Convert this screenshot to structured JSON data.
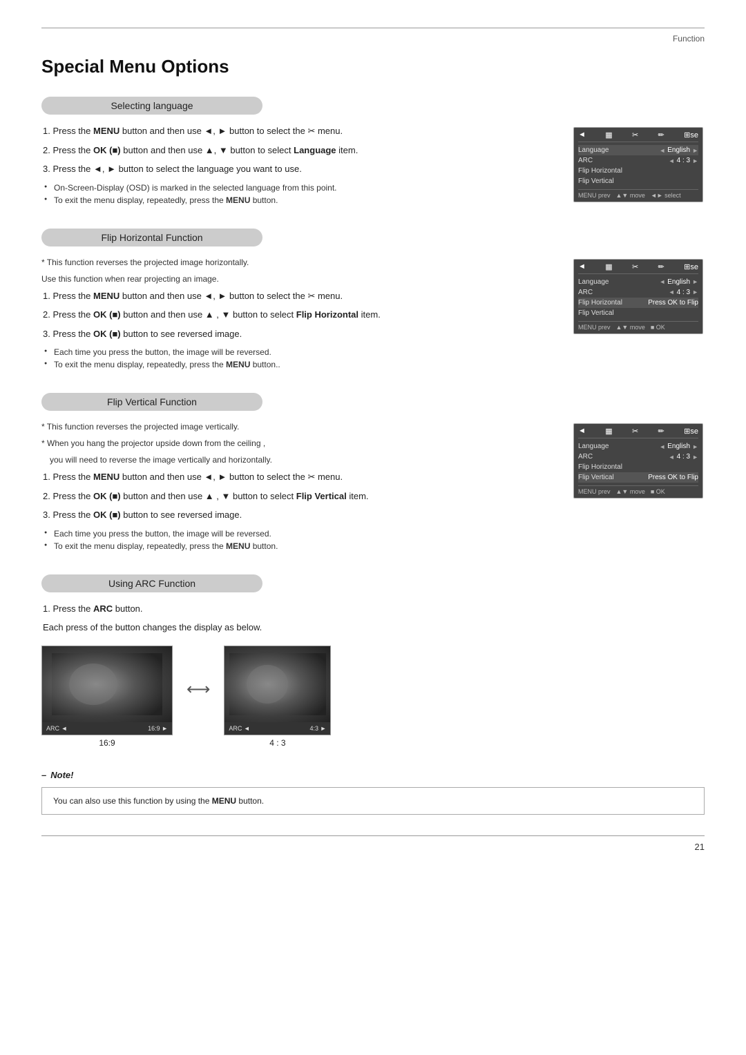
{
  "header": {
    "function_label": "Function"
  },
  "page": {
    "title": "Special Menu Options",
    "number": "21"
  },
  "sections": [
    {
      "id": "selecting-language",
      "title": "Selecting language",
      "asterisk_notes": [],
      "steps": [
        {
          "num": "1.",
          "text_before": "Press the ",
          "bold1": "MENU",
          "text_mid": " button and then use ◄, ► button to select the",
          "icon": "scissors",
          "text_after": "menu."
        },
        {
          "num": "2.",
          "text_before": "Press the ",
          "bold1": "OK (■)",
          "text_mid": " button and then use ▲, ▼ button to select ",
          "bold2": "Language",
          "text_after": " item."
        },
        {
          "num": "3.",
          "text": "Press the ◄, ► button to select the language you want to use."
        }
      ],
      "sub_notes": [
        "On-Screen-Display (OSD) is marked in the selected language from this point.",
        "To exit the menu display, repeatedly, press the MENU button."
      ],
      "menu": {
        "highlighted_row": "Language",
        "rows": [
          {
            "label": "Language",
            "arrow_left": "◄",
            "value": "English",
            "arrow_right": "►",
            "highlight": true
          },
          {
            "label": "ARC",
            "arrow_left": "◄",
            "value": "4 : 3",
            "arrow_right": "►"
          },
          {
            "label": "Flip Horizontal",
            "arrow_left": "",
            "value": "",
            "arrow_right": ""
          },
          {
            "label": "Flip Vertical",
            "arrow_left": "",
            "value": "",
            "arrow_right": ""
          }
        ],
        "footer": [
          "MENU prev",
          "▲▼ move",
          "◄► select"
        ]
      }
    },
    {
      "id": "flip-horizontal",
      "title": "Flip Horizontal Function",
      "asterisk_notes": [
        "This function reverses the projected image horizontally.",
        "Use this function when rear projecting an image."
      ],
      "steps": [
        {
          "num": "1.",
          "text_before": "Press the ",
          "bold1": "MENU",
          "text_mid": " button and then use ◄, ► button to select the",
          "icon": "scissors",
          "text_after": "menu."
        },
        {
          "num": "2.",
          "text_before": "Press the ",
          "bold1": "OK (■)",
          "text_mid": " button and then use ▲ , ▼ button to select ",
          "bold2": "Flip Horizontal",
          "text_after": " item."
        },
        {
          "num": "3.",
          "text_before": "Press the ",
          "bold1": "OK (■)",
          "text_after": " button to see reversed image."
        }
      ],
      "sub_notes": [
        "Each time you press the button, the image will be reversed.",
        "To exit the menu display, repeatedly, press the MENU button.."
      ],
      "menu": {
        "highlighted_row": "Flip Horizontal",
        "rows": [
          {
            "label": "Language",
            "arrow_left": "◄",
            "value": "English",
            "arrow_right": "►"
          },
          {
            "label": "ARC",
            "arrow_left": "◄",
            "value": "4 : 3",
            "arrow_right": "►"
          },
          {
            "label": "Flip Horizontal",
            "arrow_left": "",
            "value": "Press OK to Flip",
            "arrow_right": "",
            "highlight": true
          },
          {
            "label": "Flip Vertical",
            "arrow_left": "",
            "value": "",
            "arrow_right": ""
          }
        ],
        "footer": [
          "MENU prev",
          "▲▼ move",
          "■ OK"
        ]
      }
    },
    {
      "id": "flip-vertical",
      "title": "Flip Vertical Function",
      "asterisk_notes": [
        "This function reverses the projected image vertically.",
        "When you hang the projector upside down from the ceiling , you will need to reverse  the image vertically and horizontally."
      ],
      "steps": [
        {
          "num": "1.",
          "text_before": "Press the ",
          "bold1": "MENU",
          "text_mid": " button and then use ◄, ► button to select the",
          "icon": "scissors",
          "text_after": "menu."
        },
        {
          "num": "2.",
          "text_before": "Press the ",
          "bold1": "OK (■)",
          "text_mid": " button and then use ▲ , ▼ button to select ",
          "bold2": "Flip Vertical",
          "text_after": " item."
        },
        {
          "num": "3.",
          "text_before": "Press the ",
          "bold1": "OK (■)",
          "text_after": " button to see reversed image."
        }
      ],
      "sub_notes": [
        "Each time you press the button, the image will be reversed.",
        "To exit the menu display, repeatedly, press the MENU button."
      ],
      "menu": {
        "highlighted_row": "Flip Vertical",
        "rows": [
          {
            "label": "Language",
            "arrow_left": "◄",
            "value": "English",
            "arrow_right": "►"
          },
          {
            "label": "ARC",
            "arrow_left": "◄",
            "value": "4 : 3",
            "arrow_right": "►"
          },
          {
            "label": "Flip Horizontal",
            "arrow_left": "",
            "value": "",
            "arrow_right": ""
          },
          {
            "label": "Flip Vertical",
            "arrow_left": "",
            "value": "Press OK to Flip",
            "arrow_right": "",
            "highlight": true
          }
        ],
        "footer": [
          "MENU prev",
          "▲▼ move",
          "■ OK"
        ]
      }
    },
    {
      "id": "using-arc",
      "title": "Using ARC Function",
      "step1": "Press the ",
      "step1_bold": "ARC",
      "step1_after": " button.",
      "step1_desc": "Each press of the button changes the display as below.",
      "arc_images": [
        {
          "label": "16:9",
          "bar_left": "ARC",
          "bar_value": "16:9"
        },
        {
          "label": "4 : 3",
          "bar_left": "ARC",
          "bar_value": "4:3"
        }
      ]
    }
  ],
  "note_box": {
    "title": "Note!",
    "text_before": "You can also use this function by using the ",
    "bold": "MENU",
    "text_after": " button."
  }
}
